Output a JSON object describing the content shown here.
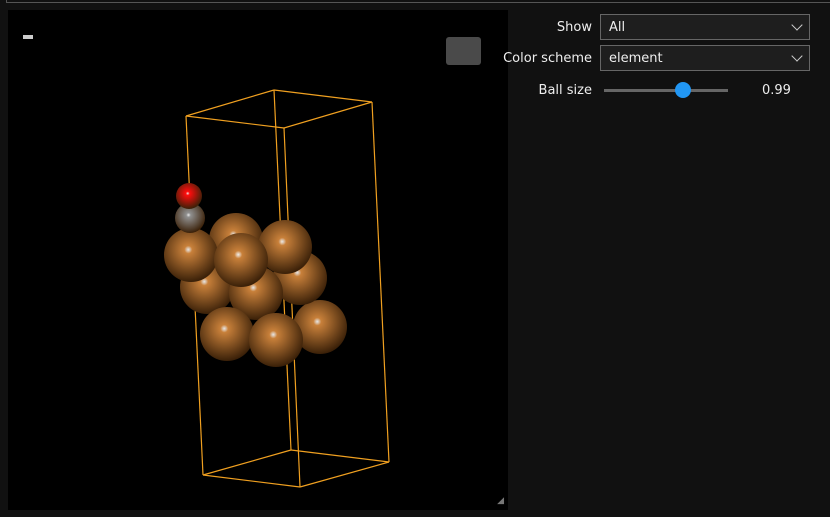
{
  "controls": {
    "show": {
      "label": "Show",
      "value": "All"
    },
    "color_scheme": {
      "label": "Color scheme",
      "value": "element"
    },
    "ball_size": {
      "label": "Ball size",
      "value": "0.99",
      "fraction": 0.66
    }
  },
  "colors": {
    "copper": "#c8803a",
    "oxygen": "#ff0d0d",
    "carbon": "#909090",
    "cell": "#f0a020",
    "accent": "#2196f3"
  }
}
